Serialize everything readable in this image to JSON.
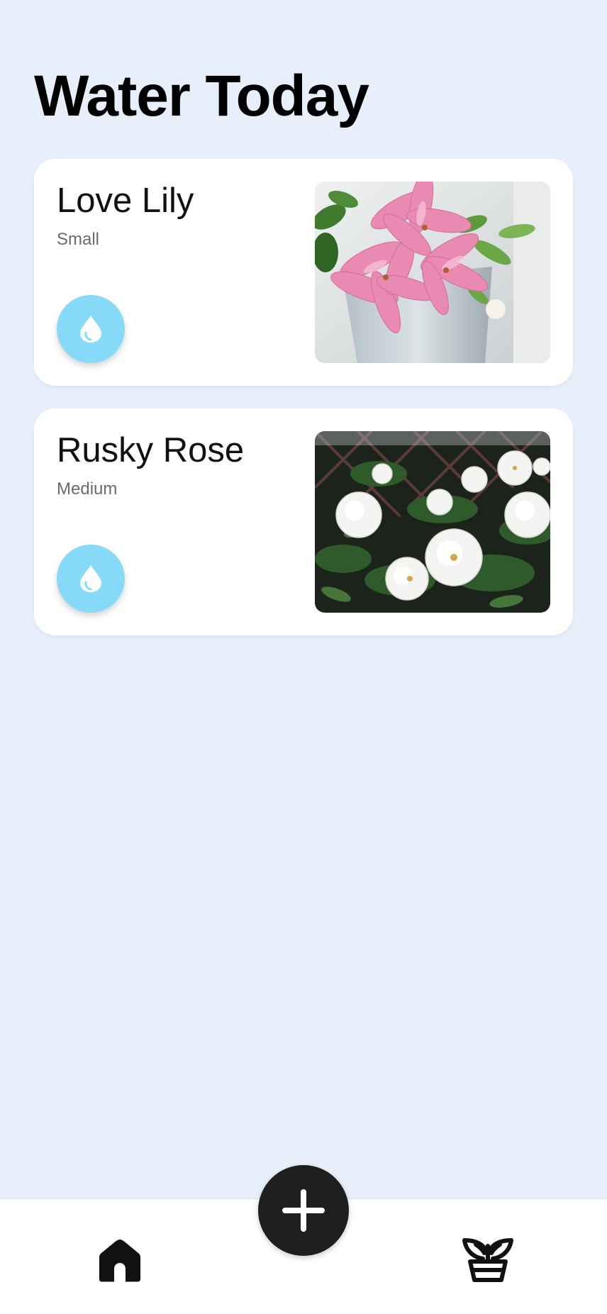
{
  "header": {
    "title": "Water Today"
  },
  "plants": [
    {
      "name": "Love Lily",
      "size": "Small",
      "water_icon": "water-drop-icon",
      "photo": "pink-lily-photo"
    },
    {
      "name": "Rusky Rose",
      "size": "Medium",
      "water_icon": "water-drop-icon",
      "photo": "white-rose-photo"
    }
  ],
  "bottom_nav": {
    "items": [
      {
        "icon": "home-icon"
      },
      {
        "icon": "add-icon"
      },
      {
        "icon": "potted-plant-icon"
      }
    ]
  },
  "colors": {
    "background": "#e7f0fa",
    "card": "#ffffff",
    "water_button": "#86d9f7",
    "fab": "#1f1f1f",
    "secondary_text": "#6a6a6a"
  }
}
